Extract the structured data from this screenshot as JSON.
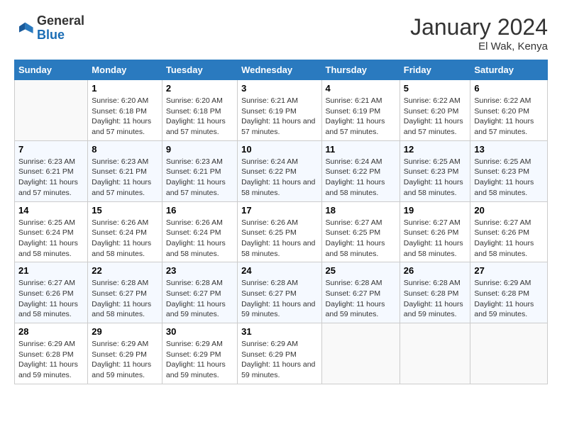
{
  "header": {
    "logo_line1": "General",
    "logo_line2": "Blue",
    "title": "January 2024",
    "subtitle": "El Wak, Kenya"
  },
  "days_of_week": [
    "Sunday",
    "Monday",
    "Tuesday",
    "Wednesday",
    "Thursday",
    "Friday",
    "Saturday"
  ],
  "weeks": [
    {
      "days": [
        {
          "num": "",
          "info": ""
        },
        {
          "num": "1",
          "info": "Sunrise: 6:20 AM\nSunset: 6:18 PM\nDaylight: 11 hours and 57 minutes."
        },
        {
          "num": "2",
          "info": "Sunrise: 6:20 AM\nSunset: 6:18 PM\nDaylight: 11 hours and 57 minutes."
        },
        {
          "num": "3",
          "info": "Sunrise: 6:21 AM\nSunset: 6:19 PM\nDaylight: 11 hours and 57 minutes."
        },
        {
          "num": "4",
          "info": "Sunrise: 6:21 AM\nSunset: 6:19 PM\nDaylight: 11 hours and 57 minutes."
        },
        {
          "num": "5",
          "info": "Sunrise: 6:22 AM\nSunset: 6:20 PM\nDaylight: 11 hours and 57 minutes."
        },
        {
          "num": "6",
          "info": "Sunrise: 6:22 AM\nSunset: 6:20 PM\nDaylight: 11 hours and 57 minutes."
        }
      ]
    },
    {
      "days": [
        {
          "num": "7",
          "info": "Sunrise: 6:23 AM\nSunset: 6:21 PM\nDaylight: 11 hours and 57 minutes."
        },
        {
          "num": "8",
          "info": "Sunrise: 6:23 AM\nSunset: 6:21 PM\nDaylight: 11 hours and 57 minutes."
        },
        {
          "num": "9",
          "info": "Sunrise: 6:23 AM\nSunset: 6:21 PM\nDaylight: 11 hours and 57 minutes."
        },
        {
          "num": "10",
          "info": "Sunrise: 6:24 AM\nSunset: 6:22 PM\nDaylight: 11 hours and 58 minutes."
        },
        {
          "num": "11",
          "info": "Sunrise: 6:24 AM\nSunset: 6:22 PM\nDaylight: 11 hours and 58 minutes."
        },
        {
          "num": "12",
          "info": "Sunrise: 6:25 AM\nSunset: 6:23 PM\nDaylight: 11 hours and 58 minutes."
        },
        {
          "num": "13",
          "info": "Sunrise: 6:25 AM\nSunset: 6:23 PM\nDaylight: 11 hours and 58 minutes."
        }
      ]
    },
    {
      "days": [
        {
          "num": "14",
          "info": "Sunrise: 6:25 AM\nSunset: 6:24 PM\nDaylight: 11 hours and 58 minutes."
        },
        {
          "num": "15",
          "info": "Sunrise: 6:26 AM\nSunset: 6:24 PM\nDaylight: 11 hours and 58 minutes."
        },
        {
          "num": "16",
          "info": "Sunrise: 6:26 AM\nSunset: 6:24 PM\nDaylight: 11 hours and 58 minutes."
        },
        {
          "num": "17",
          "info": "Sunrise: 6:26 AM\nSunset: 6:25 PM\nDaylight: 11 hours and 58 minutes."
        },
        {
          "num": "18",
          "info": "Sunrise: 6:27 AM\nSunset: 6:25 PM\nDaylight: 11 hours and 58 minutes."
        },
        {
          "num": "19",
          "info": "Sunrise: 6:27 AM\nSunset: 6:26 PM\nDaylight: 11 hours and 58 minutes."
        },
        {
          "num": "20",
          "info": "Sunrise: 6:27 AM\nSunset: 6:26 PM\nDaylight: 11 hours and 58 minutes."
        }
      ]
    },
    {
      "days": [
        {
          "num": "21",
          "info": "Sunrise: 6:27 AM\nSunset: 6:26 PM\nDaylight: 11 hours and 58 minutes."
        },
        {
          "num": "22",
          "info": "Sunrise: 6:28 AM\nSunset: 6:27 PM\nDaylight: 11 hours and 58 minutes."
        },
        {
          "num": "23",
          "info": "Sunrise: 6:28 AM\nSunset: 6:27 PM\nDaylight: 11 hours and 59 minutes."
        },
        {
          "num": "24",
          "info": "Sunrise: 6:28 AM\nSunset: 6:27 PM\nDaylight: 11 hours and 59 minutes."
        },
        {
          "num": "25",
          "info": "Sunrise: 6:28 AM\nSunset: 6:27 PM\nDaylight: 11 hours and 59 minutes."
        },
        {
          "num": "26",
          "info": "Sunrise: 6:28 AM\nSunset: 6:28 PM\nDaylight: 11 hours and 59 minutes."
        },
        {
          "num": "27",
          "info": "Sunrise: 6:29 AM\nSunset: 6:28 PM\nDaylight: 11 hours and 59 minutes."
        }
      ]
    },
    {
      "days": [
        {
          "num": "28",
          "info": "Sunrise: 6:29 AM\nSunset: 6:28 PM\nDaylight: 11 hours and 59 minutes."
        },
        {
          "num": "29",
          "info": "Sunrise: 6:29 AM\nSunset: 6:29 PM\nDaylight: 11 hours and 59 minutes."
        },
        {
          "num": "30",
          "info": "Sunrise: 6:29 AM\nSunset: 6:29 PM\nDaylight: 11 hours and 59 minutes."
        },
        {
          "num": "31",
          "info": "Sunrise: 6:29 AM\nSunset: 6:29 PM\nDaylight: 11 hours and 59 minutes."
        },
        {
          "num": "",
          "info": ""
        },
        {
          "num": "",
          "info": ""
        },
        {
          "num": "",
          "info": ""
        }
      ]
    }
  ]
}
